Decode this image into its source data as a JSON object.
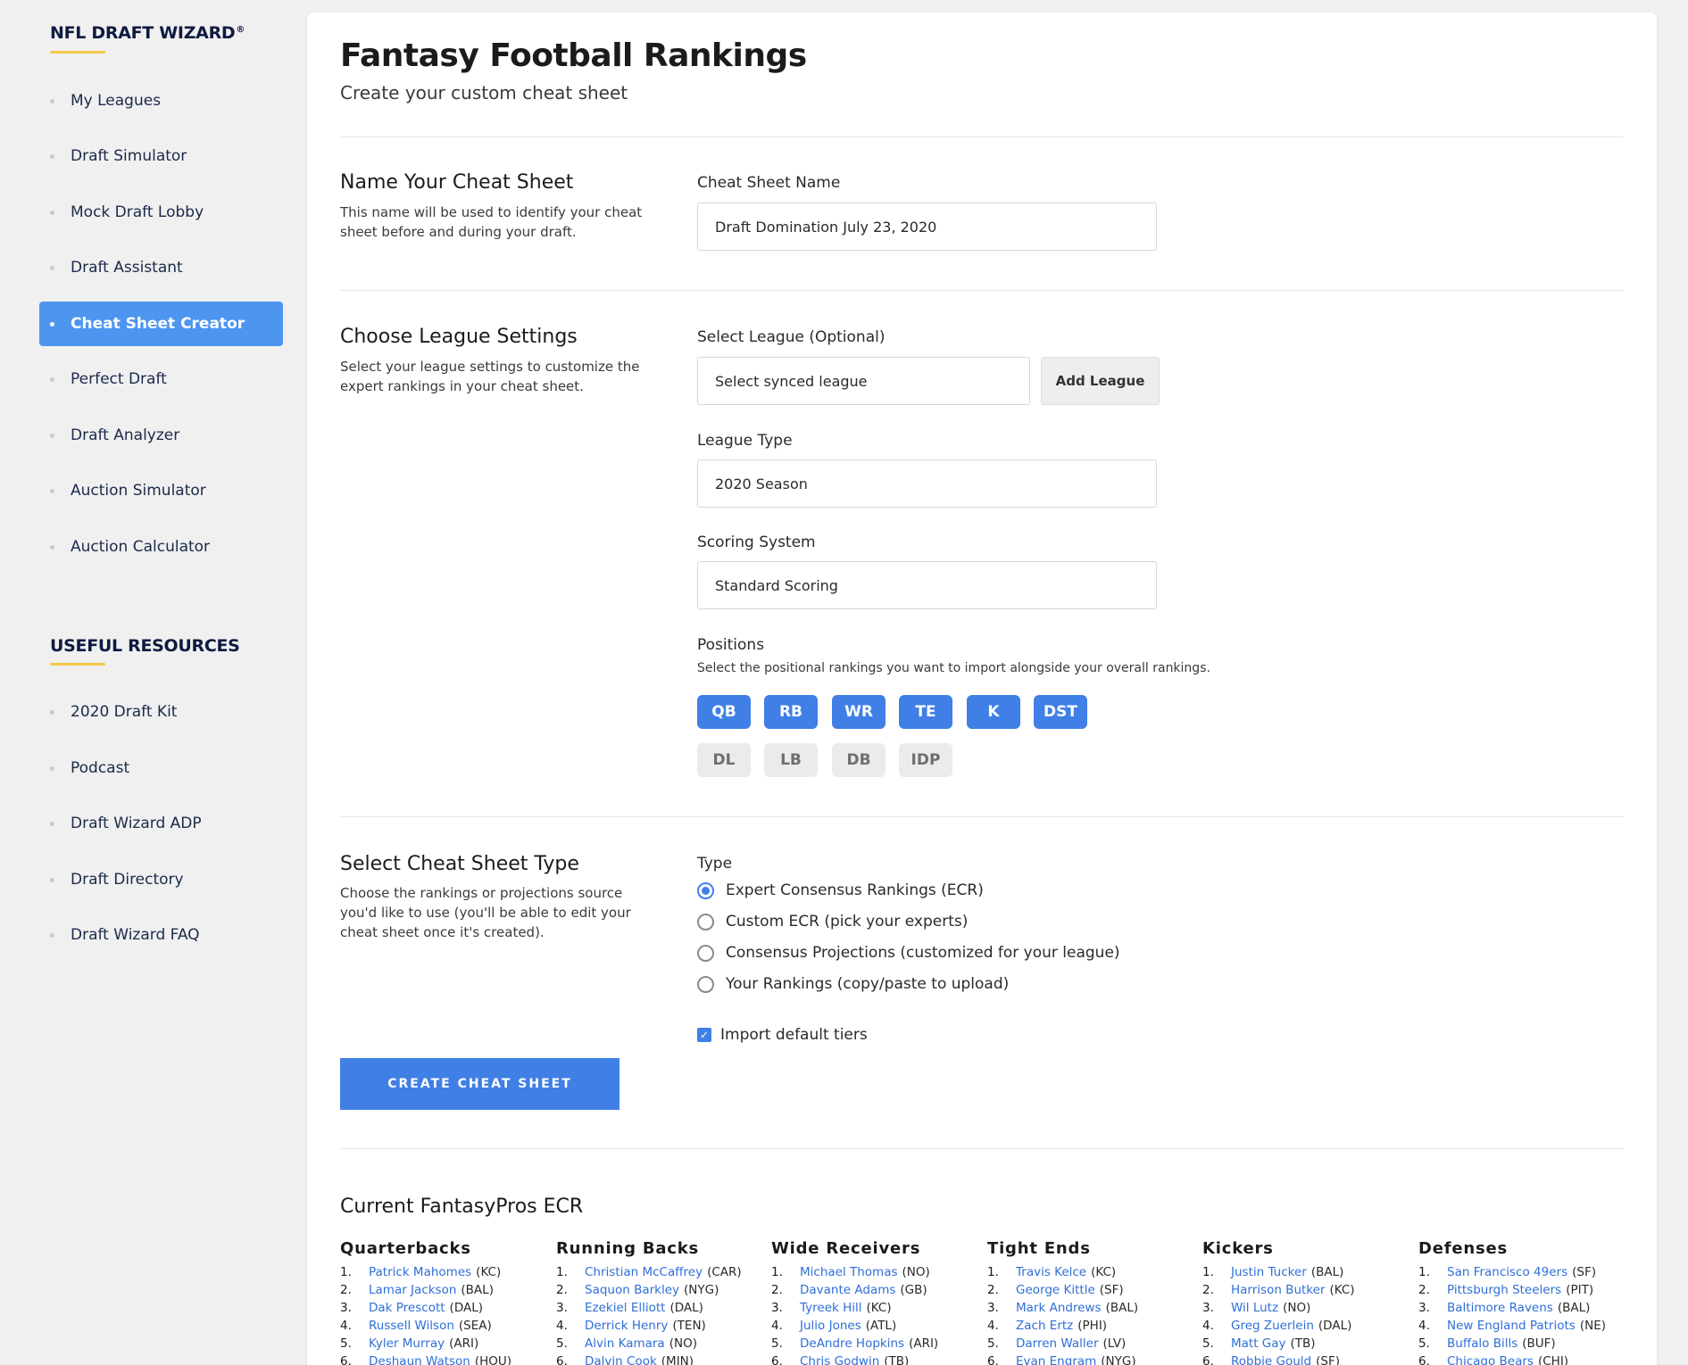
{
  "sidebar": {
    "brand": "NFL DRAFT WIZARD",
    "brand_mark": "®",
    "items": [
      {
        "label": "My Leagues",
        "active": false
      },
      {
        "label": "Draft Simulator",
        "active": false
      },
      {
        "label": "Mock Draft Lobby",
        "active": false
      },
      {
        "label": "Draft Assistant",
        "active": false
      },
      {
        "label": "Cheat Sheet Creator",
        "active": true
      },
      {
        "label": "Perfect Draft",
        "active": false
      },
      {
        "label": "Draft Analyzer",
        "active": false
      },
      {
        "label": "Auction Simulator",
        "active": false
      },
      {
        "label": "Auction Calculator",
        "active": false
      }
    ],
    "resources_heading": "USEFUL RESOURCES",
    "resources": [
      {
        "label": "2020 Draft Kit"
      },
      {
        "label": "Podcast"
      },
      {
        "label": "Draft Wizard ADP"
      },
      {
        "label": "Draft Directory"
      },
      {
        "label": "Draft Wizard FAQ"
      }
    ]
  },
  "header": {
    "title": "Fantasy Football Rankings",
    "subtitle": "Create your custom cheat sheet"
  },
  "name_section": {
    "title": "Name Your Cheat Sheet",
    "description": "This name will be used to identify your cheat sheet before and during your draft.",
    "field_label": "Cheat Sheet Name",
    "field_value": "Draft Domination July 23, 2020"
  },
  "league_section": {
    "title": "Choose League Settings",
    "description": "Select your league settings to customize the expert rankings in your cheat sheet.",
    "select_league_label": "Select League (Optional)",
    "select_league_value": "Select synced league",
    "add_league_label": "Add League",
    "league_type_label": "League Type",
    "league_type_value": "2020 Season",
    "scoring_label": "Scoring System",
    "scoring_value": "Standard Scoring",
    "positions_label": "Positions",
    "positions_hint": "Select the positional rankings you want to import alongside your overall rankings.",
    "positions": [
      {
        "label": "QB",
        "selected": true
      },
      {
        "label": "RB",
        "selected": true
      },
      {
        "label": "WR",
        "selected": true
      },
      {
        "label": "TE",
        "selected": true
      },
      {
        "label": "K",
        "selected": true
      },
      {
        "label": "DST",
        "selected": true
      },
      {
        "label": "DL",
        "selected": false
      },
      {
        "label": "LB",
        "selected": false
      },
      {
        "label": "DB",
        "selected": false
      },
      {
        "label": "IDP",
        "selected": false
      }
    ]
  },
  "type_section": {
    "title": "Select Cheat Sheet Type",
    "description": "Choose the rankings or projections source you'd like to use (you'll be able to edit your cheat sheet once it's created).",
    "type_label": "Type",
    "options": [
      {
        "label": "Expert Consensus Rankings (ECR)",
        "selected": true
      },
      {
        "label": "Custom ECR (pick your experts)",
        "selected": false
      },
      {
        "label": "Consensus Projections (customized for your league)",
        "selected": false
      },
      {
        "label": "Your Rankings (copy/paste to upload)",
        "selected": false
      }
    ],
    "import_tiers_label": "Import default tiers",
    "import_tiers_checked": true,
    "create_button": "CREATE CHEAT SHEET"
  },
  "ecr": {
    "title": "Current FantasyPros ECR",
    "columns": [
      {
        "heading": "Quarterbacks",
        "rows": [
          {
            "n": "1.",
            "player": "Patrick Mahomes",
            "team": "(KC)"
          },
          {
            "n": "2.",
            "player": "Lamar Jackson",
            "team": "(BAL)"
          },
          {
            "n": "3.",
            "player": "Dak Prescott",
            "team": "(DAL)"
          },
          {
            "n": "4.",
            "player": "Russell Wilson",
            "team": "(SEA)"
          },
          {
            "n": "5.",
            "player": "Kyler Murray",
            "team": "(ARI)"
          },
          {
            "n": "6.",
            "player": "Deshaun Watson",
            "team": "(HOU)"
          }
        ]
      },
      {
        "heading": "Running Backs",
        "rows": [
          {
            "n": "1.",
            "player": "Christian McCaffrey",
            "team": "(CAR)"
          },
          {
            "n": "2.",
            "player": "Saquon Barkley",
            "team": "(NYG)"
          },
          {
            "n": "3.",
            "player": "Ezekiel Elliott",
            "team": "(DAL)"
          },
          {
            "n": "4.",
            "player": "Derrick Henry",
            "team": "(TEN)"
          },
          {
            "n": "5.",
            "player": "Alvin Kamara",
            "team": "(NO)"
          },
          {
            "n": "6.",
            "player": "Dalvin Cook",
            "team": "(MIN)"
          }
        ]
      },
      {
        "heading": "Wide Receivers",
        "rows": [
          {
            "n": "1.",
            "player": "Michael Thomas",
            "team": "(NO)"
          },
          {
            "n": "2.",
            "player": "Davante Adams",
            "team": "(GB)"
          },
          {
            "n": "3.",
            "player": "Tyreek Hill",
            "team": "(KC)"
          },
          {
            "n": "4.",
            "player": "Julio Jones",
            "team": "(ATL)"
          },
          {
            "n": "5.",
            "player": "DeAndre Hopkins",
            "team": "(ARI)"
          },
          {
            "n": "6.",
            "player": "Chris Godwin",
            "team": "(TB)"
          }
        ]
      },
      {
        "heading": "Tight Ends",
        "rows": [
          {
            "n": "1.",
            "player": "Travis Kelce",
            "team": "(KC)"
          },
          {
            "n": "2.",
            "player": "George Kittle",
            "team": "(SF)"
          },
          {
            "n": "3.",
            "player": "Mark Andrews",
            "team": "(BAL)"
          },
          {
            "n": "4.",
            "player": "Zach Ertz",
            "team": "(PHI)"
          },
          {
            "n": "5.",
            "player": "Darren Waller",
            "team": "(LV)"
          },
          {
            "n": "6.",
            "player": "Evan Engram",
            "team": "(NYG)"
          }
        ]
      },
      {
        "heading": "Kickers",
        "rows": [
          {
            "n": "1.",
            "player": "Justin Tucker",
            "team": "(BAL)"
          },
          {
            "n": "2.",
            "player": "Harrison Butker",
            "team": "(KC)"
          },
          {
            "n": "3.",
            "player": "Wil Lutz",
            "team": "(NO)"
          },
          {
            "n": "4.",
            "player": "Greg Zuerlein",
            "team": "(DAL)"
          },
          {
            "n": "5.",
            "player": "Matt Gay",
            "team": "(TB)"
          },
          {
            "n": "6.",
            "player": "Robbie Gould",
            "team": "(SF)"
          }
        ]
      },
      {
        "heading": "Defenses",
        "rows": [
          {
            "n": "1.",
            "player": "San Francisco 49ers",
            "team": "(SF)"
          },
          {
            "n": "2.",
            "player": "Pittsburgh Steelers",
            "team": "(PIT)"
          },
          {
            "n": "3.",
            "player": "Baltimore Ravens",
            "team": "(BAL)"
          },
          {
            "n": "4.",
            "player": "New England Patriots",
            "team": "(NE)"
          },
          {
            "n": "5.",
            "player": "Buffalo Bills",
            "team": "(BUF)"
          },
          {
            "n": "6.",
            "player": "Chicago Bears",
            "team": "(CHI)"
          }
        ]
      }
    ]
  },
  "colors": {
    "accent": "#3f7fe6",
    "sidebar_active": "#4e95f0",
    "brand_underline": "#f4c94a",
    "link": "#2f6fd6"
  }
}
